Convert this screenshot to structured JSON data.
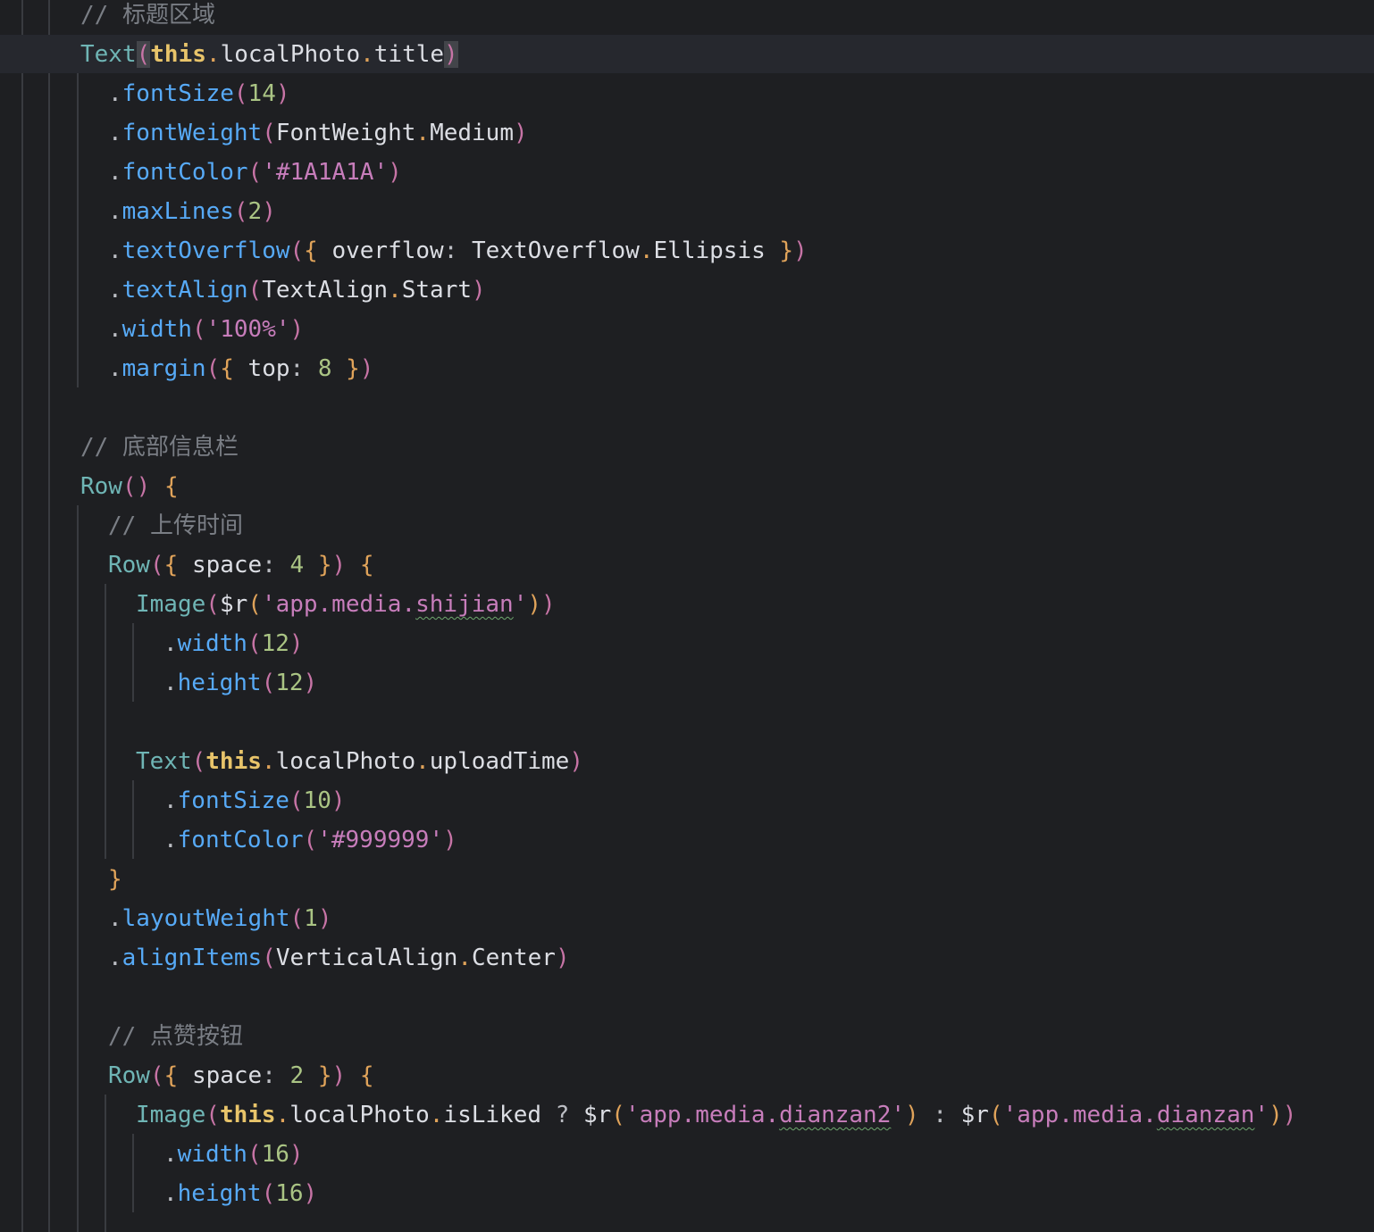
{
  "editor": {
    "theme_colors": {
      "background": "#1e1f22",
      "current_line": "#26282e",
      "comment": "#7a7e85",
      "component": "#6fb5b5",
      "method": "#57aaf7",
      "number": "#aac484",
      "string": "#c77dbb",
      "keyword": "#e8c46a",
      "bracket_orange": "#e0a35a",
      "bracket_pink": "#c774a6"
    },
    "code_lines": [
      "// 标题区域",
      "Text(this.localPhoto.title)",
      "  .fontSize(14)",
      "  .fontWeight(FontWeight.Medium)",
      "  .fontColor('#1A1A1A')",
      "  .maxLines(2)",
      "  .textOverflow({ overflow: TextOverflow.Ellipsis })",
      "  .textAlign(TextAlign.Start)",
      "  .width('100%')",
      "  .margin({ top: 8 })",
      "",
      "// 底部信息栏",
      "Row() {",
      "  // 上传时间",
      "  Row({ space: 4 }) {",
      "    Image($r('app.media.shijian'))",
      "      .width(12)",
      "      .height(12)",
      "",
      "    Text(this.localPhoto.uploadTime)",
      "      .fontSize(10)",
      "      .fontColor('#999999')",
      "  }",
      "  .layoutWeight(1)",
      "  .alignItems(VerticalAlign.Center)",
      "",
      "  // 点赞按钮",
      "  Row({ space: 2 }) {",
      "    Image(this.localPhoto.isLiked ? $r('app.media.dianzan2') : $r('app.media.dianzan'))",
      "      .width(16)",
      "      .height(16)"
    ]
  }
}
